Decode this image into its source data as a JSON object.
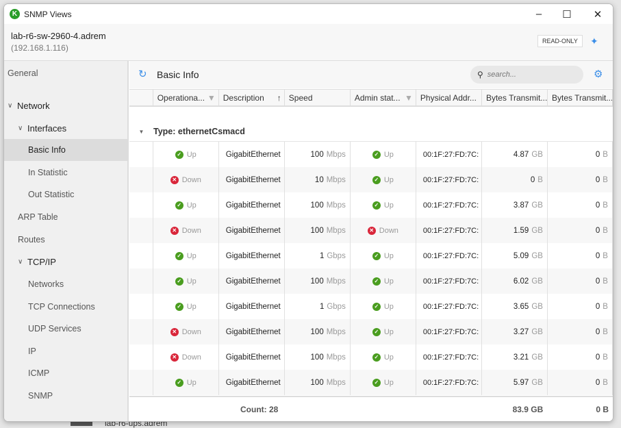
{
  "background": {
    "behind_text": "lab-r6-ups.adrem"
  },
  "window": {
    "title": "SNMP Views",
    "logo_letter": "K"
  },
  "header": {
    "host": "lab-r6-sw-2960-4.adrem",
    "ip": "(192.168.1.116)",
    "mode_badge": "READ-ONLY"
  },
  "sidebar": {
    "items": [
      {
        "label": "General",
        "level": 0
      },
      {
        "label": "Network",
        "level": 0,
        "expanded": true
      },
      {
        "label": "Interfaces",
        "level": 1,
        "expanded": true
      },
      {
        "label": "Basic Info",
        "level": 2,
        "selected": true
      },
      {
        "label": "In Statistic",
        "level": 2
      },
      {
        "label": "Out Statistic",
        "level": 2
      },
      {
        "label": "ARP Table",
        "level": 1
      },
      {
        "label": "Routes",
        "level": 1
      },
      {
        "label": "TCP/IP",
        "level": 1,
        "expanded": true
      },
      {
        "label": "Networks",
        "level": 2
      },
      {
        "label": "TCP Connections",
        "level": 2
      },
      {
        "label": "UDP Services",
        "level": 2
      },
      {
        "label": "IP",
        "level": 2
      },
      {
        "label": "ICMP",
        "level": 2
      },
      {
        "label": "SNMP",
        "level": 2
      }
    ]
  },
  "toolbar": {
    "title": "Basic Info",
    "search_placeholder": "search..."
  },
  "table": {
    "columns": [
      "Operationa...",
      "Description",
      "Speed",
      "Admin stat...",
      "Physical Addr...",
      "Bytes Transmit...",
      "Bytes Transmit..."
    ],
    "group": "Type: ethernetCsmacd",
    "rows": [
      [
        "Up",
        "GigabitEthernet",
        "100",
        "Mbps",
        "Up",
        "00:1F:27:FD:7C:",
        "4.87",
        "GB",
        "0",
        "B"
      ],
      [
        "Down",
        "GigabitEthernet",
        "10",
        "Mbps",
        "Up",
        "00:1F:27:FD:7C:",
        "0",
        "B",
        "0",
        "B"
      ],
      [
        "Up",
        "GigabitEthernet",
        "100",
        "Mbps",
        "Up",
        "00:1F:27:FD:7C:",
        "3.87",
        "GB",
        "0",
        "B"
      ],
      [
        "Down",
        "GigabitEthernet",
        "100",
        "Mbps",
        "Down",
        "00:1F:27:FD:7C:",
        "1.59",
        "GB",
        "0",
        "B"
      ],
      [
        "Up",
        "GigabitEthernet",
        "1",
        "Gbps",
        "Up",
        "00:1F:27:FD:7C:",
        "5.09",
        "GB",
        "0",
        "B"
      ],
      [
        "Up",
        "GigabitEthernet",
        "100",
        "Mbps",
        "Up",
        "00:1F:27:FD:7C:",
        "6.02",
        "GB",
        "0",
        "B"
      ],
      [
        "Up",
        "GigabitEthernet",
        "1",
        "Gbps",
        "Up",
        "00:1F:27:FD:7C:",
        "3.65",
        "GB",
        "0",
        "B"
      ],
      [
        "Down",
        "GigabitEthernet",
        "100",
        "Mbps",
        "Up",
        "00:1F:27:FD:7C:",
        "3.27",
        "GB",
        "0",
        "B"
      ],
      [
        "Down",
        "GigabitEthernet",
        "100",
        "Mbps",
        "Up",
        "00:1F:27:FD:7C:",
        "3.21",
        "GB",
        "0",
        "B"
      ],
      [
        "Up",
        "GigabitEthernet",
        "100",
        "Mbps",
        "Up",
        "00:1F:27:FD:7C:",
        "5.97",
        "GB",
        "0",
        "B"
      ]
    ],
    "footer": {
      "count": "Count: 28",
      "bytes_tx_total": "83.9 GB",
      "bytes_tx2_total": "0 B"
    }
  },
  "colors": {
    "accent": "#3b8ee8",
    "up": "#4a9d1f",
    "down": "#d9263a"
  }
}
